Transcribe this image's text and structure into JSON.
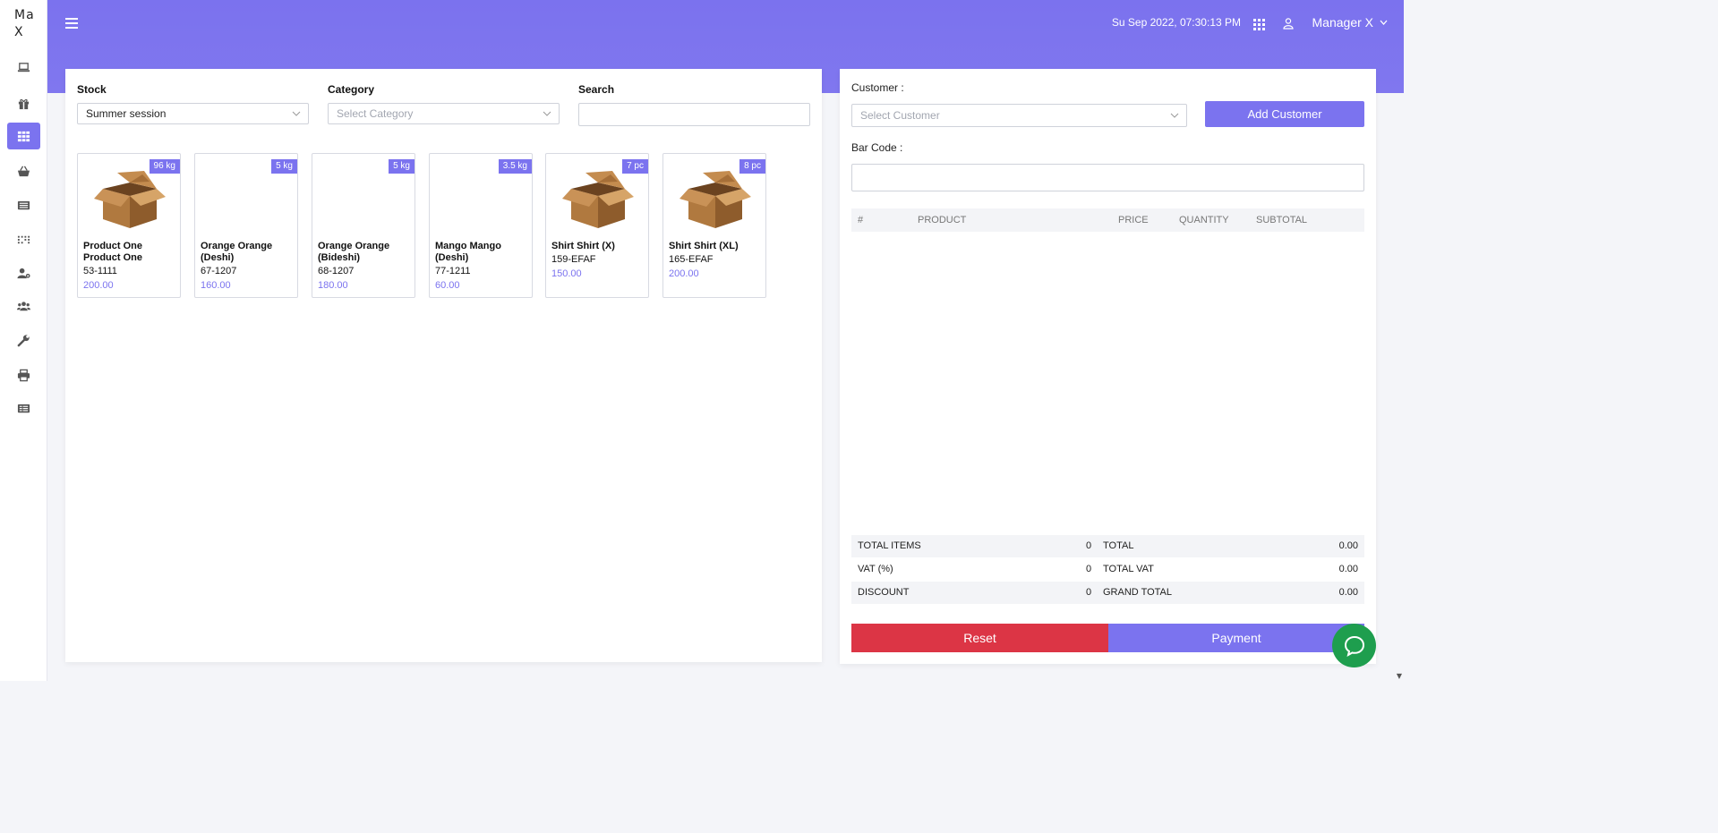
{
  "app": {
    "logo": "Ma X"
  },
  "sidebar": {
    "items": [
      {
        "icon": "laptop-icon"
      },
      {
        "icon": "gift-icon"
      },
      {
        "icon": "grid-icon",
        "active": true
      },
      {
        "icon": "basket-icon"
      },
      {
        "icon": "list-icon"
      },
      {
        "icon": "barcode-icon"
      },
      {
        "icon": "user-cog-icon"
      },
      {
        "icon": "users-icon"
      },
      {
        "icon": "wrench-icon"
      },
      {
        "icon": "printer-icon"
      },
      {
        "icon": "report-icon"
      }
    ]
  },
  "header": {
    "datetime": "Su Sep 2022, 07:30:13 PM",
    "user": "Manager X"
  },
  "filters": {
    "stock_label": "Stock",
    "stock_value": "Summer session",
    "category_label": "Category",
    "category_placeholder": "Select Category",
    "search_label": "Search",
    "search_value": ""
  },
  "products": [
    {
      "badge": "96 kg",
      "name": "Product One Product One",
      "code": "53-1111",
      "price": "200.00",
      "image": true
    },
    {
      "badge": "5 kg",
      "name": "Orange Orange (Deshi)",
      "code": "67-1207",
      "price": "160.00",
      "image": false
    },
    {
      "badge": "5 kg",
      "name": "Orange Orange (Bideshi)",
      "code": "68-1207",
      "price": "180.00",
      "image": false
    },
    {
      "badge": "3.5 kg",
      "name": "Mango Mango (Deshi)",
      "code": "77-1211",
      "price": "60.00",
      "image": false
    },
    {
      "badge": "7 pc",
      "name": "Shirt Shirt (X)",
      "code": "159-EFAF",
      "price": "150.00",
      "image": true
    },
    {
      "badge": "8 pc",
      "name": "Shirt Shirt (XL)",
      "code": "165-EFAF",
      "price": "200.00",
      "image": true
    }
  ],
  "cart": {
    "customer_label": "Customer :",
    "customer_placeholder": "Select Customer",
    "add_customer": "Add Customer",
    "barcode_label": "Bar Code :",
    "barcode_value": "",
    "columns": {
      "num": "#",
      "product": "PRODUCT",
      "price": "PRICE",
      "quantity": "QUANTITY",
      "subtotal": "SUBTOTAL"
    },
    "summary": {
      "total_items_label": "TOTAL ITEMS",
      "total_items": "0",
      "total_label": "TOTAL",
      "total": "0.00",
      "vat_label": "VAT (%)",
      "vat": "0",
      "total_vat_label": "TOTAL VAT",
      "total_vat": "0.00",
      "discount_label": "DISCOUNT",
      "discount": "0",
      "grand_total_label": "GRAND TOTAL",
      "grand_total": "0.00"
    },
    "reset": "Reset",
    "payment": "Payment"
  },
  "colors": {
    "accent": "#7b73ef",
    "danger": "#dc3545",
    "chat": "#1e9e4e"
  }
}
